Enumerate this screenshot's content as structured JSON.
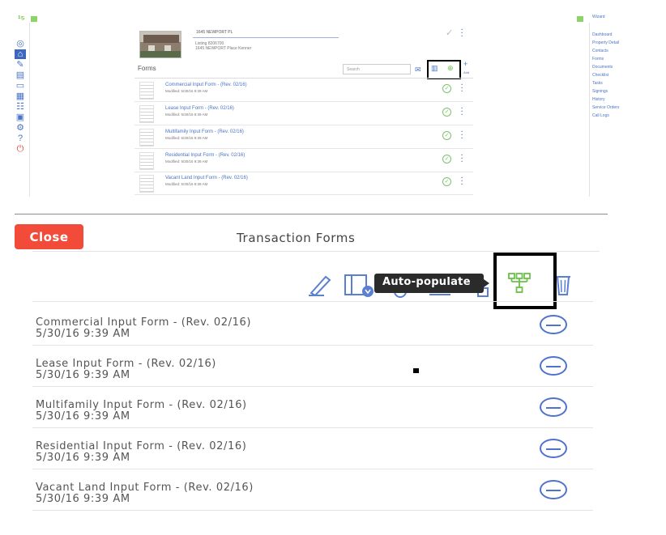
{
  "app": {
    "logo": "¹⁵",
    "rail_icons": [
      "dashboard-icon",
      "home-icon",
      "edit-icon",
      "document-icon",
      "folder-icon",
      "calendar-icon",
      "contacts-icon",
      "id-card-icon",
      "settings-icon",
      "help-icon",
      "power-icon"
    ]
  },
  "property": {
    "address": "1645 NEWPORT PL",
    "listing_id": "Listing 8206700",
    "listing_address": "1645 NEWPORT Place Kenner"
  },
  "mini_forms": {
    "title": "Forms",
    "search_placeholder": "Search",
    "add_label": "Add",
    "rows": [
      {
        "name": "Commercial Input Form - (Rev. 02/16)",
        "modified": "Modified: 5/30/16 9:39 AM"
      },
      {
        "name": "Lease Input Form - (Rev. 02/16)",
        "modified": "Modified: 5/30/16 9:39 AM"
      },
      {
        "name": "Multifamily Input Form - (Rev. 02/16)",
        "modified": "Modified: 5/30/16 9:39 AM"
      },
      {
        "name": "Residential Input Form - (Rev. 02/16)",
        "modified": "Modified: 5/30/16 9:39 AM"
      },
      {
        "name": "Vacant Land Input Form - (Rev. 02/16)",
        "modified": "Modified: 5/30/16 9:39 AM"
      }
    ]
  },
  "right_menu": {
    "wizard": "Wizard",
    "items": [
      "Dashboard",
      "Property Detail",
      "Contacts",
      "Forms",
      "Documents",
      "Checklist",
      "Tasks",
      "Signings",
      "History",
      "Service Orders",
      "Call Logs"
    ]
  },
  "panel": {
    "close_label": "Close",
    "title": "Transaction Forms",
    "tooltip": "Auto-populate",
    "forms": [
      {
        "name": "Commercial Input Form - (Rev. 02/16)",
        "date": "5/30/16 9:39 AM"
      },
      {
        "name": "Lease Input Form - (Rev. 02/16)",
        "date": "5/30/16 9:39 AM"
      },
      {
        "name": "Multifamily Input Form - (Rev. 02/16)",
        "date": "5/30/16 9:39 AM"
      },
      {
        "name": "Residential Input Form - (Rev. 02/16)",
        "date": "5/30/16 9:39 AM"
      },
      {
        "name": "Vacant Land Input Form - (Rev. 02/16)",
        "date": "5/30/16 9:39 AM"
      }
    ]
  },
  "colors": {
    "accent_blue": "#5b7fd1",
    "close_red": "#f24b3a",
    "auto_populate_green": "#6cc04a"
  }
}
